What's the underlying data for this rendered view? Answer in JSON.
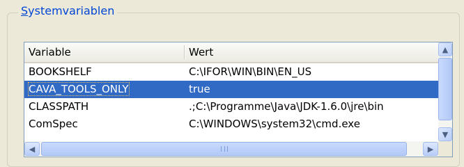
{
  "group": {
    "title_first": "S",
    "title_rest": "ystemvariablen"
  },
  "table": {
    "columns": [
      "Variable",
      "Wert"
    ],
    "rows": [
      {
        "name": "BOOKSHELF",
        "value": "C:\\IFOR\\WIN\\BIN\\EN_US",
        "selected": false
      },
      {
        "name": "CAVA_TOOLS_ONLY",
        "value": "true",
        "selected": true
      },
      {
        "name": "CLASSPATH",
        "value": ".;C:\\Programme\\Java\\JDK-1.6.0\\jre\\bin",
        "selected": false
      },
      {
        "name": "ComSpec",
        "value": "C:\\WINDOWS\\system32\\cmd.exe",
        "selected": false
      }
    ]
  },
  "icons": {
    "scroll_up": "chevron-up-icon",
    "scroll_down": "chevron-down-icon",
    "scroll_left": "chevron-left-icon",
    "scroll_right": "chevron-right-icon"
  },
  "colors": {
    "selection": "#316ac5",
    "group_title": "#0046d5",
    "background": "#ece9d8"
  }
}
